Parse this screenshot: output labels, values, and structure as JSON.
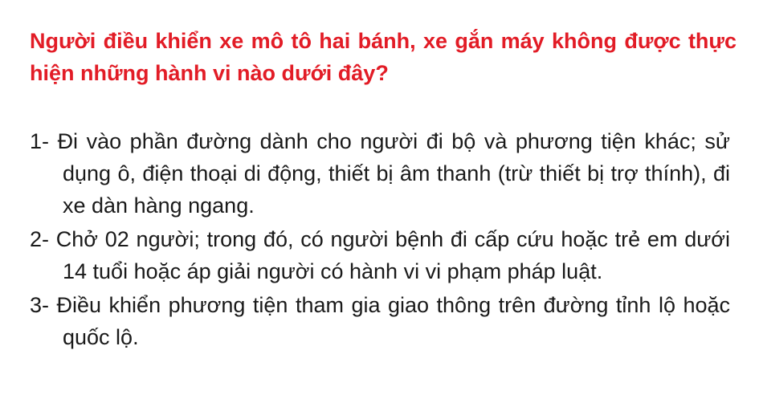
{
  "question": "Người điều khiển xe mô tô hai bánh, xe gắn máy không được thực hiện những hành vi nào dưới đây?",
  "options": [
    {
      "number": "1-",
      "text": "Đi vào phần đường dành cho người đi bộ và phương tiện khác; sử dụng ô, điện thoại di động, thiết bị âm thanh (trừ thiết bị trợ thính), đi xe dàn hàng ngang."
    },
    {
      "number": "2-",
      "text": "Chở 02 người; trong đó, có người bệnh đi cấp cứu hoặc trẻ em dưới 14 tuổi hoặc áp giải người có hành vi vi phạm pháp luật."
    },
    {
      "number": "3-",
      "text": "Điều khiển phương tiện tham gia giao thông trên đường tỉnh lộ hoặc quốc lộ."
    }
  ],
  "colors": {
    "question": "#e21c26",
    "body_text": "#1a1a1a",
    "background": "#ffffff"
  }
}
